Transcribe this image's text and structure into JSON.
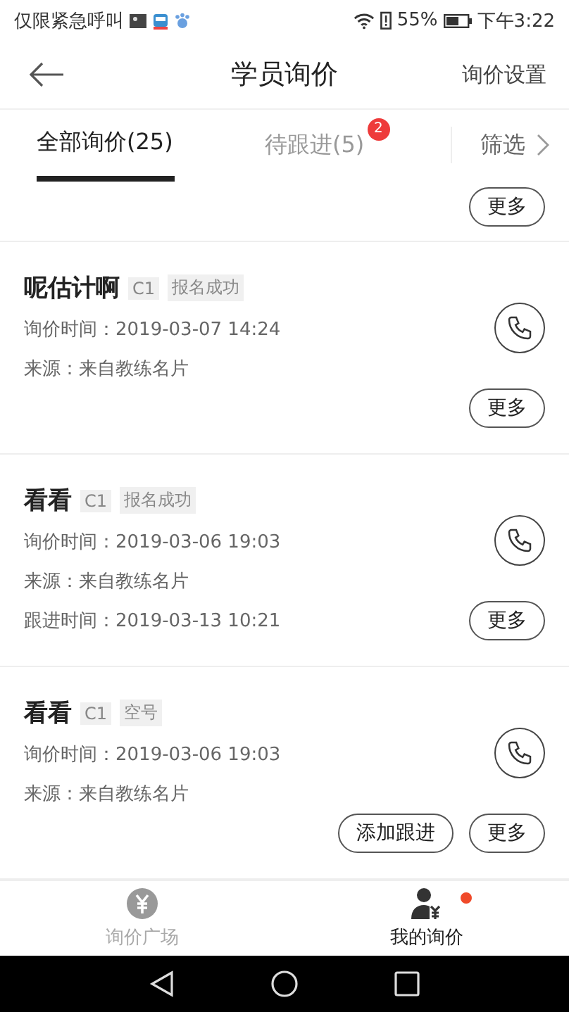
{
  "status_bar": {
    "carrier": "仅限紧急呼叫",
    "battery": "55%",
    "time": "下午3:22"
  },
  "header": {
    "title": "学员询价",
    "action": "询价设置"
  },
  "tabs": [
    {
      "label": "全部询价(25)",
      "selected": true
    },
    {
      "label": "待跟进(5)",
      "selected": false,
      "badge": "2"
    }
  ],
  "filter": {
    "label": "筛选"
  },
  "partial_card": {
    "buttons": [
      "更多"
    ]
  },
  "inquiries": [
    {
      "name": "呢估计啊",
      "license": "C1",
      "status": "报名成功",
      "lines": [
        "询价时间：2019-03-07 14:24",
        "来源：来自教练名片"
      ],
      "buttons": [
        "更多"
      ]
    },
    {
      "name": "看看",
      "license": "C1",
      "status": "报名成功",
      "lines": [
        "询价时间：2019-03-06 19:03",
        "来源：来自教练名片"
      ],
      "follow_up": "跟进时间：2019-03-13 10:21",
      "buttons": [
        "更多"
      ]
    },
    {
      "name": "看看",
      "license": "C1",
      "status": "空号",
      "lines": [
        "询价时间：2019-03-06 19:03",
        "来源：来自教练名片"
      ],
      "buttons": [
        "添加跟进",
        "更多"
      ]
    }
  ],
  "bottom_nav": [
    {
      "label": "询价广场",
      "selected": false,
      "kind": "plaza",
      "dot": false
    },
    {
      "label": "我的询价",
      "selected": true,
      "kind": "mine",
      "dot": true
    }
  ]
}
